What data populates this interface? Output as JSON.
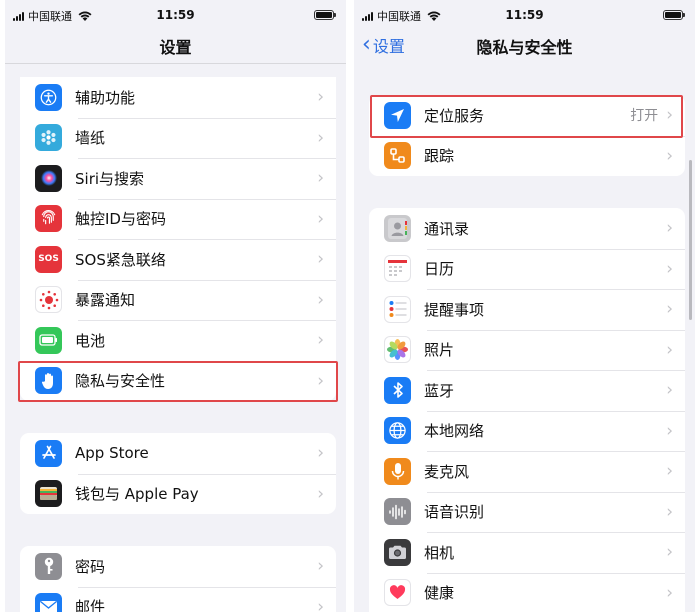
{
  "status_bar": {
    "carrier": "中国联通",
    "time": "11:59"
  },
  "left": {
    "title": "设置",
    "group1": [
      {
        "label": "辅助功能",
        "icon": "accessibility-icon",
        "color": "#1a7cf5"
      },
      {
        "label": "墙纸",
        "icon": "wallpaper-icon",
        "color": "#34aadc"
      },
      {
        "label": "Siri与搜索",
        "icon": "siri-icon",
        "color": "#1c1c1e"
      },
      {
        "label": "触控ID与密码",
        "icon": "fingerprint-icon",
        "color": "#e5343b"
      },
      {
        "label": "SOS紧急联络",
        "icon": "sos-icon",
        "color": "#e5343b"
      },
      {
        "label": "暴露通知",
        "icon": "exposure-icon",
        "color": "#ffffff"
      },
      {
        "label": "电池",
        "icon": "battery-icon",
        "color": "#34c759"
      },
      {
        "label": "隐私与安全性",
        "icon": "hand-icon",
        "color": "#1a7cf5"
      }
    ],
    "group2": [
      {
        "label": "App Store",
        "icon": "appstore-icon",
        "color": "#1a7cf5"
      },
      {
        "label": "钱包与 Apple Pay",
        "icon": "wallet-icon",
        "color": "#1c1c1e"
      }
    ],
    "group3": [
      {
        "label": "密码",
        "icon": "key-icon",
        "color": "#8e8e93"
      },
      {
        "label": "邮件",
        "icon": "mail-icon",
        "color": "#1a7cf5"
      }
    ]
  },
  "right": {
    "back_label": "设置",
    "title": "隐私与安全性",
    "group1": [
      {
        "label": "定位服务",
        "value": "打开",
        "icon": "location-icon",
        "color": "#1a7cf5"
      },
      {
        "label": "跟踪",
        "icon": "tracking-icon",
        "color": "#f08a1c"
      }
    ],
    "group2": [
      {
        "label": "通讯录",
        "icon": "contacts-icon",
        "color": "#c9c9cc"
      },
      {
        "label": "日历",
        "icon": "calendar-icon",
        "color": "#ffffff"
      },
      {
        "label": "提醒事项",
        "icon": "reminders-icon",
        "color": "#ffffff"
      },
      {
        "label": "照片",
        "icon": "photos-icon",
        "color": "#ffffff"
      },
      {
        "label": "蓝牙",
        "icon": "bluetooth-icon",
        "color": "#1a7cf5"
      },
      {
        "label": "本地网络",
        "icon": "globe-icon",
        "color": "#1a7cf5"
      },
      {
        "label": "麦克风",
        "icon": "microphone-icon",
        "color": "#f08a1c"
      },
      {
        "label": "语音识别",
        "icon": "waveform-icon",
        "color": "#8e8e93"
      },
      {
        "label": "相机",
        "icon": "camera-icon",
        "color": "#3a3a3c"
      },
      {
        "label": "健康",
        "icon": "health-icon",
        "color": "#ffffff"
      }
    ]
  }
}
